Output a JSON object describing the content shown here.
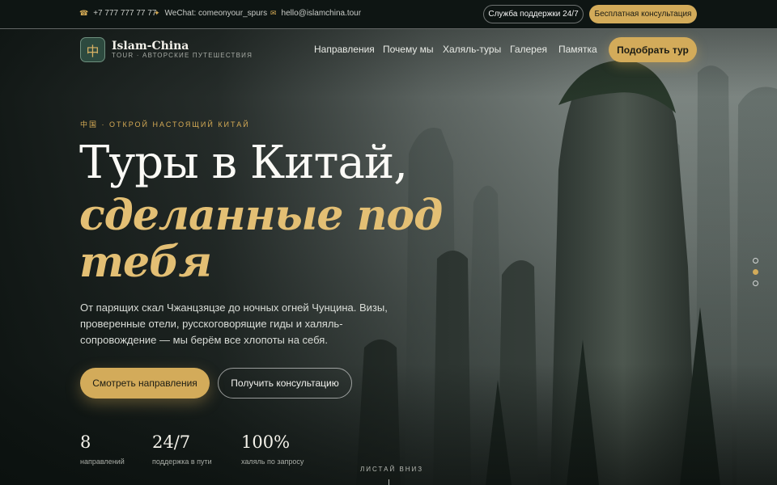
{
  "topbar": {
    "phone": "+7 777 777 77 77",
    "phone_icon": "phone-icon",
    "wechat": "WeChat: comeonyour_spurs",
    "wechat_icon": "sparkle-icon",
    "email": "hello@islamchina.tour",
    "email_icon": "mail-icon",
    "support_label": "Служба поддержки 24/7",
    "consult_label": "Бесплатная консультация"
  },
  "header": {
    "logo_char": "中",
    "logo_name": "Islam-China",
    "logo_tagline": "TOUR · АВТОРСКИЕ ПУТЕШЕСТВИЯ",
    "nav": [
      "Направления",
      "Почему мы",
      "Халяль-туры",
      "Галерея",
      "Памятка"
    ],
    "cta_label": "Подобрать тур"
  },
  "hero": {
    "eyebrow": "中国 · ОТКРОЙ НАСТОЯЩИЙ КИТАЙ",
    "title_line1": "Туры в Китай,",
    "title_line2": "сделанные под",
    "title_line3": "тебя",
    "lead": "От парящих скал Чжанцзяцзе до ночных огней Чунцина. Визы, проверенные отели, русскоговорящие гиды и халяль-сопровождение — мы берём все хлопоты на себя.",
    "primary_label": "Смотреть направления",
    "secondary_label": "Получить консультацию",
    "stats": [
      {
        "value": "8",
        "label": "направлений"
      },
      {
        "value": "24/7",
        "label": "поддержка в пути"
      },
      {
        "value": "100%",
        "label": "халяль по запросу"
      }
    ],
    "scroll_hint": "ЛИСТАЙ ВНИЗ",
    "slides_active": 2
  },
  "colors": {
    "accent": "#d3ab5a",
    "accent_text": "#e3bf74",
    "topbar_bg": "#0e1513"
  }
}
